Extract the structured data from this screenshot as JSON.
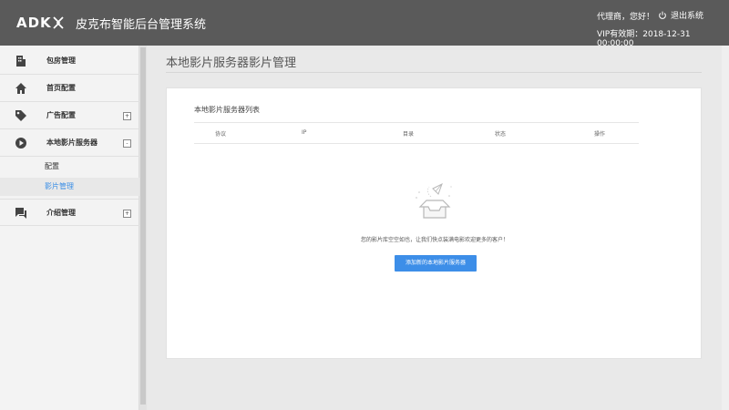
{
  "header": {
    "logo_text": "ADK",
    "title": "皮克布智能后台管理系统",
    "greeting": "代理商，您好！",
    "logout_label": "退出系统",
    "vip_expiry": "VIP有效期：2018-12-31 00:00:00"
  },
  "sidebar": {
    "items": [
      {
        "label": "包房管理",
        "icon": "building-icon"
      },
      {
        "label": "首页配置",
        "icon": "home-icon"
      },
      {
        "label": "广告配置",
        "icon": "tag-icon",
        "toggle": "+"
      },
      {
        "label": "本地影片服务器",
        "icon": "play-circle-icon",
        "toggle": "-"
      },
      {
        "label": "介绍管理",
        "icon": "chat-icon",
        "toggle": "+"
      }
    ],
    "sub_items": [
      {
        "label": "配置"
      },
      {
        "label": "影片管理"
      }
    ]
  },
  "main": {
    "page_title": "本地影片服务器影片管理",
    "card_title": "本地影片服务器列表",
    "columns": [
      "协议",
      "IP",
      "目录",
      "状态",
      "操作"
    ],
    "empty_text": "您的影片库空空如也，让我们快点装满电影欢迎更多的客户！",
    "add_button": "添加新的本地影片服务器"
  },
  "colors": {
    "header_bg": "#5a5a5a",
    "accent": "#3d8ee8",
    "sidebar_bg": "#f3f3f3"
  }
}
